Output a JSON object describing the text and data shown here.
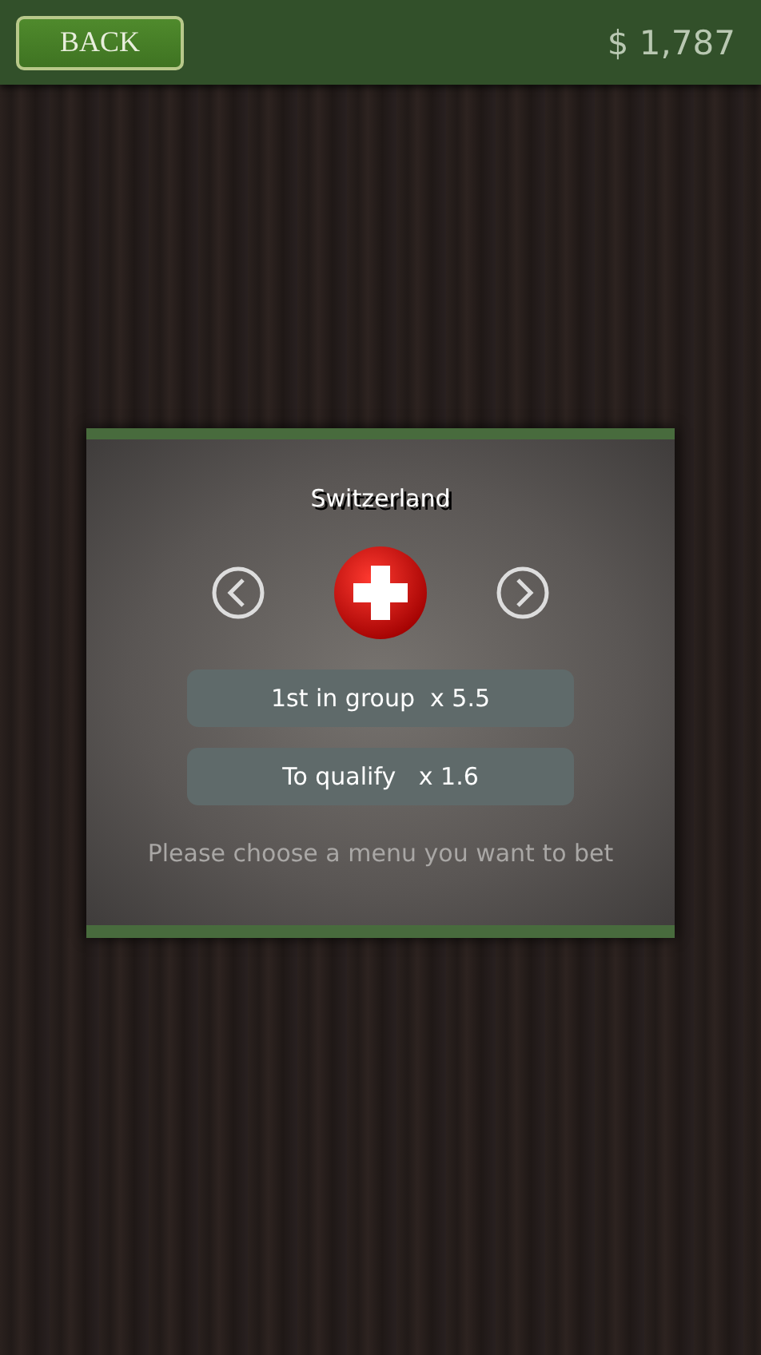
{
  "top_bar": {
    "back_button": "BACK",
    "balance": "$ 1,787"
  },
  "dialog": {
    "team": "Switzerland",
    "bet_options": [
      "1st in group  x 5.5",
      "To qualify   x 1.6"
    ],
    "hint": "Please choose a menu you want to bet"
  }
}
